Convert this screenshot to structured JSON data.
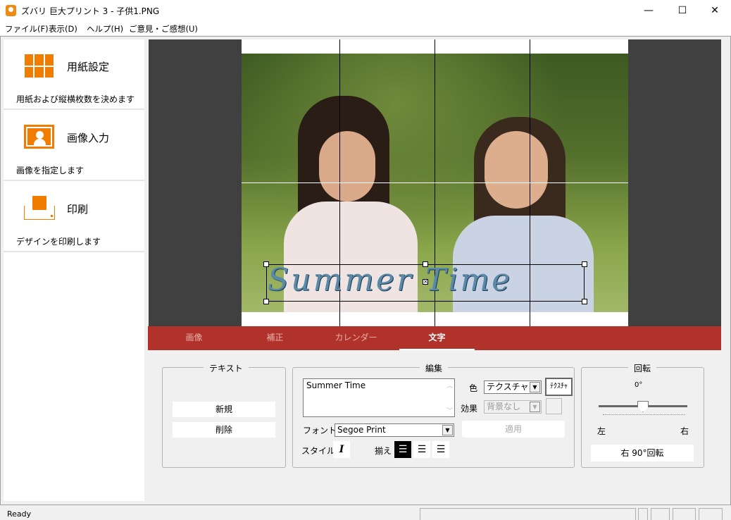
{
  "window": {
    "title": "ズバリ 巨大プリント 3 - 子供1.PNG",
    "minimize": "—",
    "maximize": "☐",
    "close": "✕"
  },
  "menu": [
    "ファイル(F)",
    "表示(D)",
    "ヘルプ(H)",
    "ご意見・ご感想(U)"
  ],
  "sidebar": {
    "items": [
      {
        "title": "用紙設定",
        "desc": "用紙および縦横枚数を決めます",
        "icon": "grid-icon"
      },
      {
        "title": "画像入力",
        "desc": "画像を指定します",
        "icon": "image-icon"
      },
      {
        "title": "印刷",
        "desc": "デザインを印刷します",
        "icon": "printer-icon"
      }
    ]
  },
  "canvas": {
    "overlay_text": "Summer Time"
  },
  "tabs": [
    {
      "label": "画像"
    },
    {
      "label": "補正"
    },
    {
      "label": "カレンダー"
    },
    {
      "label": "文字",
      "active": true
    }
  ],
  "text_group": {
    "title": "テキスト",
    "new": "新規",
    "delete": "削除"
  },
  "edit_group": {
    "title": "編集",
    "text_value": "Summer Time",
    "color_label": "色",
    "color_value": "テクスチャ",
    "texture_button": "ﾃｸｽﾁｬ",
    "effect_label": "効果",
    "effect_value": "背景なし",
    "font_label": "フォント",
    "font_value": "Segoe Print",
    "apply": "適用",
    "style_label": "スタイル",
    "italic": "I",
    "align_label": "揃え"
  },
  "rotate_group": {
    "title": "回転",
    "angle": "0°",
    "left": "左",
    "right": "右",
    "rotate_right": "右 90°回転",
    "slider_value_deg": 0
  },
  "status": {
    "text": "Ready"
  },
  "colors": {
    "accent": "#b0322a",
    "icon_orange": "#f07c00"
  }
}
